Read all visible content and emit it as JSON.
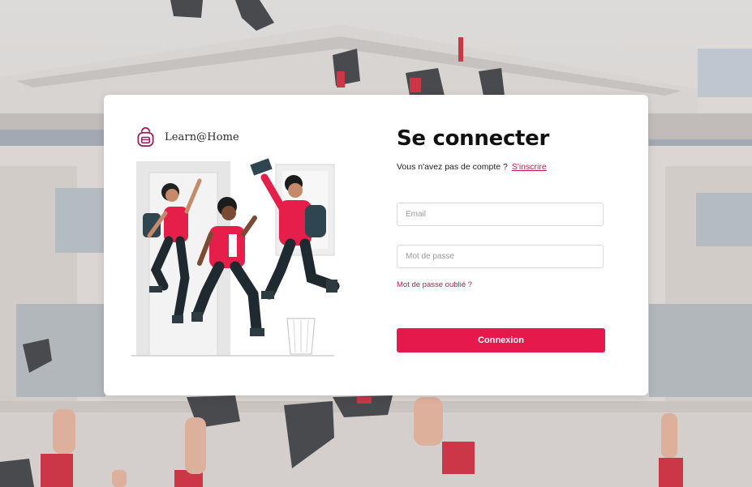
{
  "brand": {
    "name": "Learn@Home",
    "logo_icon": "backpack-icon",
    "accent_color": "#e5194c",
    "link_color": "#c8174a"
  },
  "login": {
    "title": "Se connecter",
    "no_account_text": "Vous n'avez pas de compte ?",
    "signup_link": "S'inscrire",
    "email_placeholder": "Email",
    "password_placeholder": "Mot de passe",
    "forgot_password": "Mot de passe oublié ?",
    "submit_label": "Connexion"
  }
}
